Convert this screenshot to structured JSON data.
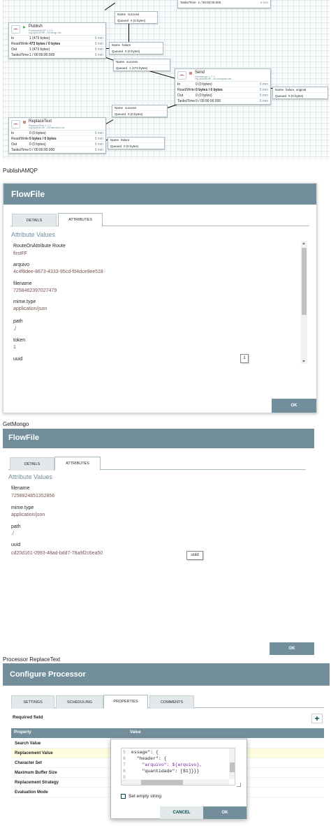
{
  "canvas": {
    "top_conn": {
      "tasks_label": "Tasks/Time",
      "tasks_value": "1 / 00:00:00.009",
      "tasks_time": "5 min"
    },
    "conn_success_1": {
      "name_label": "Name",
      "name": "success",
      "queued_label": "Queued",
      "queued": "0 (0 bytes)"
    },
    "publish": {
      "name": "Publish",
      "type": "PublishAMQP 1.7.1",
      "bundle": "org.apache.nifi - nifi-amqp-nar",
      "rows": [
        {
          "k": "In",
          "v": "1 (473 bytes)",
          "t": "5 min"
        },
        {
          "k": "Read/Write",
          "v": "473 bytes / 0 bytes",
          "t": "5 min"
        },
        {
          "k": "Out",
          "v": "1 (473 bytes)",
          "t": "5 min"
        },
        {
          "k": "Tasks/Time",
          "v": "1 / 00:00:00.009",
          "t": "5 min"
        }
      ]
    },
    "conn_failure_1": {
      "name_label": "Name",
      "name": "failure",
      "queued_label": "Queued",
      "queued": "0 (0 bytes)"
    },
    "conn_success_2": {
      "name_label": "Name",
      "name": "success",
      "queued_label": "Queued",
      "queued": "1 (473 bytes)"
    },
    "send": {
      "name": "Send",
      "type": "GetMongo 1.7.1",
      "bundle": "org.apache.nifi - nifi-mongodb-nar",
      "rows": [
        {
          "k": "In",
          "v": "0 (0 bytes)",
          "t": "5 min"
        },
        {
          "k": "Read/Write",
          "v": "0 bytes / 0 bytes",
          "t": "5 min"
        },
        {
          "k": "Out",
          "v": "0 (0 bytes)",
          "t": "5 min"
        },
        {
          "k": "Tasks/Time",
          "v": "0 / 00:00:00.000",
          "t": "5 min"
        }
      ]
    },
    "conn_failure_original": {
      "name_label": "Name",
      "name": "failure, original",
      "queued_label": "Queued",
      "queued": "0 (0 bytes)"
    },
    "conn_success_3": {
      "name_label": "Name",
      "name": "success",
      "queued_label": "Queued",
      "queued": "0 (0 bytes)"
    },
    "replace": {
      "name": "ReplaceText",
      "type": "ReplaceText 1.7.1",
      "bundle": "org.apache.nifi - nifi-standard-nar",
      "rows": [
        {
          "k": "In",
          "v": "0 (0 bytes)",
          "t": "5 min"
        },
        {
          "k": "Read/Write",
          "v": "0 bytes / 0 bytes",
          "t": "5 min"
        },
        {
          "k": "Out",
          "v": "0 (0 bytes)",
          "t": "5 min"
        },
        {
          "k": "Tasks/Time",
          "v": "0 / 00:00:00.000",
          "t": "5 min"
        }
      ]
    },
    "conn_failure_2": {
      "name_label": "Name",
      "name": "failure",
      "queued_label": "Queued",
      "queued": "0 (0 bytes)"
    }
  },
  "captions": {
    "publish": "PublishAMQP",
    "getmongo": "GetMongo",
    "replace": "Processor ReplaceText"
  },
  "flowfile1": {
    "title": "FlowFile",
    "tabs": [
      "DETAILS",
      "ATTRIBUTES"
    ],
    "section": "Attribute Values",
    "attributes": [
      {
        "name": "RouteOnAttribute Route",
        "value": "firstFF"
      },
      {
        "name": "arquivo",
        "value": "4c4f8dee-8673-4333-95cd-f04dce9ee518"
      },
      {
        "name": "filename",
        "value": "7258462397027479"
      },
      {
        "name": "mime.type",
        "value": "application/json"
      },
      {
        "name": "path",
        "value": "./"
      },
      {
        "name": "token",
        "value": "1"
      },
      {
        "name": "uuid",
        "value": ""
      }
    ],
    "tooltip": "1",
    "ok": "OK"
  },
  "flowfile2": {
    "title": "FlowFile",
    "tabs": [
      "DETAILS",
      "ATTRIBUTES"
    ],
    "section": "Attribute Values",
    "attributes": [
      {
        "name": "filename",
        "value": "7258824851352856"
      },
      {
        "name": "mime.type",
        "value": "application/json"
      },
      {
        "name": "path",
        "value": "./"
      },
      {
        "name": "uuid",
        "value": "cd20d161-0993-48ad-bdd7-78a9f2c6ea50"
      }
    ],
    "tooltip": "uuid",
    "ok": "OK"
  },
  "configure": {
    "title": "Configure Processor",
    "tabs": [
      "SETTINGS",
      "SCHEDULING",
      "PROPERTIES",
      "COMMENTS"
    ],
    "required": "Required field",
    "add": "+",
    "col_property": "Property",
    "col_value": "Value",
    "properties": [
      "Search Value",
      "Replacement Value",
      "Character Set",
      "Maximum Buffer Size",
      "Replacement Strategy",
      "Evaluation Mode"
    ],
    "editor": {
      "lines": [
        {
          "n": "5",
          "text": "essage\": {"
        },
        {
          "n": "6",
          "text": "  \"header\": {"
        },
        {
          "n": "7",
          "text": "    \"arquivo\": ${arquivo},"
        },
        {
          "n": "8",
          "text": "    \"quantidade\": [$1]}}}"
        },
        {
          "n": "9",
          "text": ""
        }
      ],
      "checkbox_label": "Set empty string",
      "cancel": "CANCEL",
      "ok": "OK"
    }
  },
  "colors": {
    "header": "#728e9b",
    "value": "#775351",
    "highlight": "#fffde0"
  }
}
